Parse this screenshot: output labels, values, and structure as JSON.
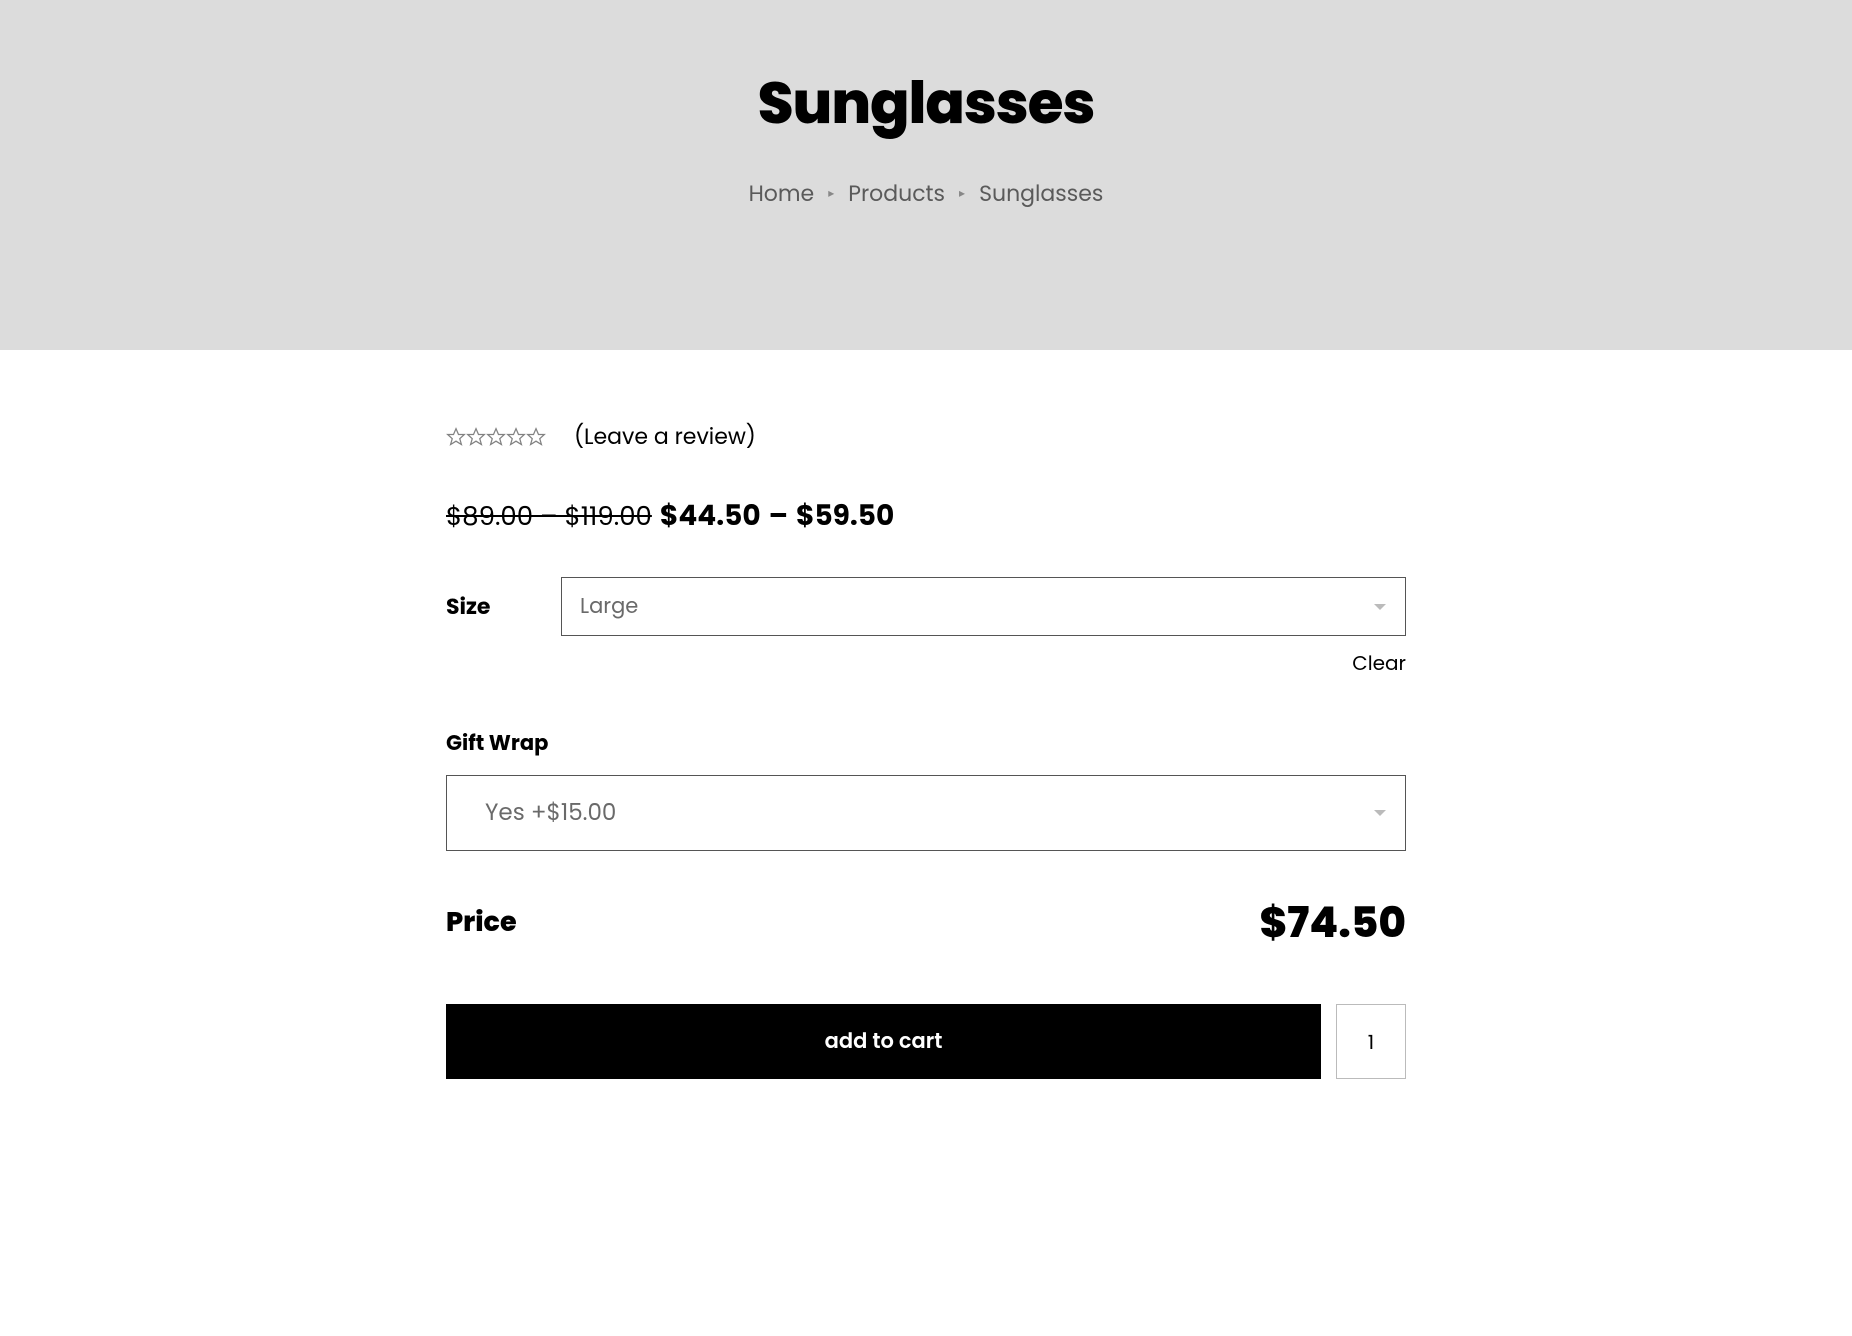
{
  "header": {
    "title": "Sunglasses",
    "breadcrumb": {
      "home": "Home",
      "products": "Products",
      "current": "Sunglasses"
    }
  },
  "product": {
    "review_link": "(Leave a review)",
    "old_price_range": "$89.00 – $119.00",
    "new_price_low_currency": "$",
    "new_price_low": "44.50",
    "new_price_high_currency": "$",
    "new_price_high": "59.50",
    "size_label": "Size",
    "size_selected": "Large",
    "clear_label": "Clear",
    "giftwrap_label": "Gift Wrap",
    "giftwrap_selected": "Yes +$15.00",
    "price_label": "Price",
    "price_total": "$74.50",
    "add_to_cart": "add to cart",
    "quantity": "1"
  }
}
